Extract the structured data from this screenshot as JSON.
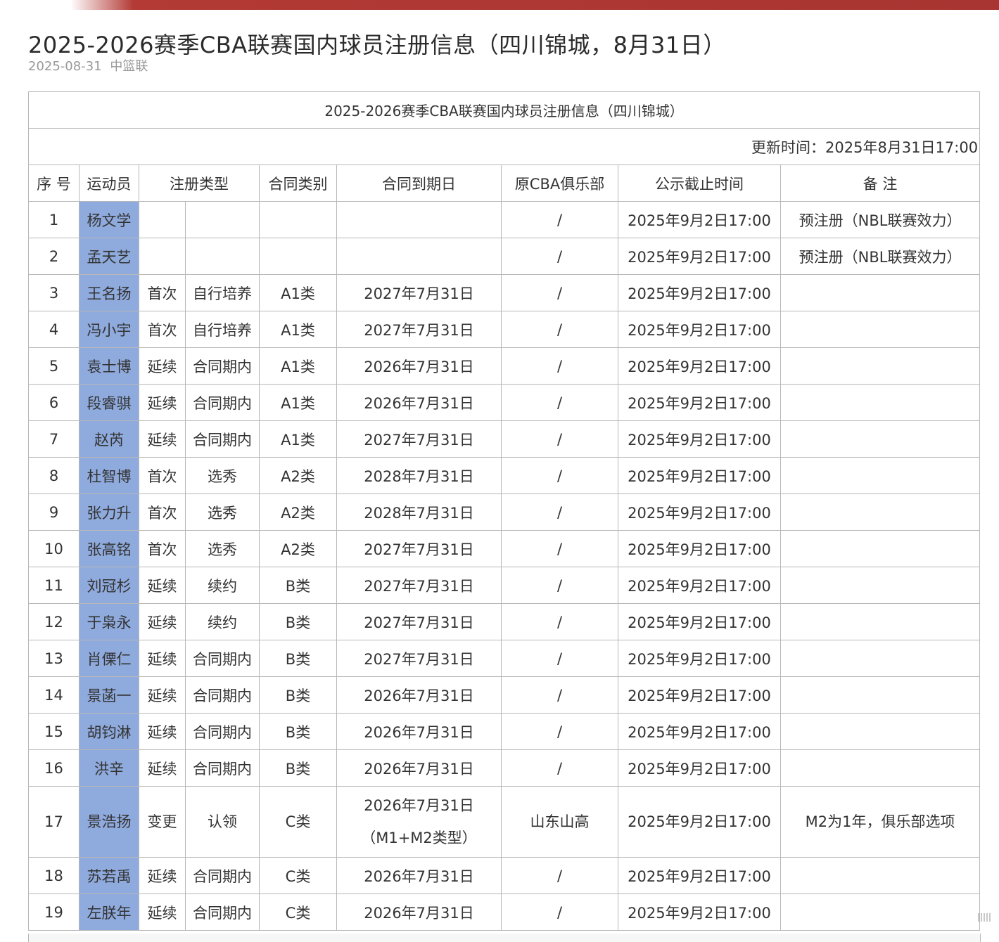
{
  "article": {
    "title": "2025-2026赛季CBA联赛国内球员注册信息（四川锦城，8月31日）",
    "date": "2025-08-31",
    "source": "中篮联"
  },
  "table": {
    "title": "2025-2026赛季CBA联赛国内球员注册信息（四川锦城）",
    "updated": "更新时间：2025年8月31日17:00",
    "headers": {
      "index": "序 号",
      "player": "运动员",
      "reg_type": "注册类型",
      "contract_class": "合同类别",
      "expiry": "合同到期日",
      "prev_club": "原CBA俱乐部",
      "deadline": "公示截止时间",
      "note": "备 注"
    },
    "rows": [
      {
        "no": "1",
        "player": "杨文学",
        "reg1": "",
        "reg2": "",
        "class": "",
        "expiry": "",
        "expiry2": "",
        "prev": "/",
        "deadline": "2025年9月2日17:00",
        "note": "预注册（NBL联赛效力）"
      },
      {
        "no": "2",
        "player": "孟天艺",
        "reg1": "",
        "reg2": "",
        "class": "",
        "expiry": "",
        "expiry2": "",
        "prev": "/",
        "deadline": "2025年9月2日17:00",
        "note": "预注册（NBL联赛效力）"
      },
      {
        "no": "3",
        "player": "王名扬",
        "reg1": "首次",
        "reg2": "自行培养",
        "class": "A1类",
        "expiry": "2027年7月31日",
        "expiry2": "",
        "prev": "/",
        "deadline": "2025年9月2日17:00",
        "note": ""
      },
      {
        "no": "4",
        "player": "冯小宇",
        "reg1": "首次",
        "reg2": "自行培养",
        "class": "A1类",
        "expiry": "2027年7月31日",
        "expiry2": "",
        "prev": "/",
        "deadline": "2025年9月2日17:00",
        "note": ""
      },
      {
        "no": "5",
        "player": "袁士博",
        "reg1": "延续",
        "reg2": "合同期内",
        "class": "A1类",
        "expiry": "2026年7月31日",
        "expiry2": "",
        "prev": "/",
        "deadline": "2025年9月2日17:00",
        "note": ""
      },
      {
        "no": "6",
        "player": "段睿骐",
        "reg1": "延续",
        "reg2": "合同期内",
        "class": "A1类",
        "expiry": "2026年7月31日",
        "expiry2": "",
        "prev": "/",
        "deadline": "2025年9月2日17:00",
        "note": ""
      },
      {
        "no": "7",
        "player": "赵芮",
        "reg1": "延续",
        "reg2": "合同期内",
        "class": "A1类",
        "expiry": "2027年7月31日",
        "expiry2": "",
        "prev": "/",
        "deadline": "2025年9月2日17:00",
        "note": ""
      },
      {
        "no": "8",
        "player": "杜智博",
        "reg1": "首次",
        "reg2": "选秀",
        "class": "A2类",
        "expiry": "2028年7月31日",
        "expiry2": "",
        "prev": "/",
        "deadline": "2025年9月2日17:00",
        "note": ""
      },
      {
        "no": "9",
        "player": "张力升",
        "reg1": "首次",
        "reg2": "选秀",
        "class": "A2类",
        "expiry": "2028年7月31日",
        "expiry2": "",
        "prev": "/",
        "deadline": "2025年9月2日17:00",
        "note": ""
      },
      {
        "no": "10",
        "player": "张高铭",
        "reg1": "首次",
        "reg2": "选秀",
        "class": "A2类",
        "expiry": "2027年7月31日",
        "expiry2": "",
        "prev": "/",
        "deadline": "2025年9月2日17:00",
        "note": ""
      },
      {
        "no": "11",
        "player": "刘冠杉",
        "reg1": "延续",
        "reg2": "续约",
        "class": "B类",
        "expiry": "2027年7月31日",
        "expiry2": "",
        "prev": "/",
        "deadline": "2025年9月2日17:00",
        "note": ""
      },
      {
        "no": "12",
        "player": "于枭永",
        "reg1": "延续",
        "reg2": "续约",
        "class": "B类",
        "expiry": "2027年7月31日",
        "expiry2": "",
        "prev": "/",
        "deadline": "2025年9月2日17:00",
        "note": ""
      },
      {
        "no": "13",
        "player": "肖傈仁",
        "reg1": "延续",
        "reg2": "合同期内",
        "class": "B类",
        "expiry": "2027年7月31日",
        "expiry2": "",
        "prev": "/",
        "deadline": "2025年9月2日17:00",
        "note": ""
      },
      {
        "no": "14",
        "player": "景菡一",
        "reg1": "延续",
        "reg2": "合同期内",
        "class": "B类",
        "expiry": "2026年7月31日",
        "expiry2": "",
        "prev": "/",
        "deadline": "2025年9月2日17:00",
        "note": ""
      },
      {
        "no": "15",
        "player": "胡钧淋",
        "reg1": "延续",
        "reg2": "合同期内",
        "class": "B类",
        "expiry": "2026年7月31日",
        "expiry2": "",
        "prev": "/",
        "deadline": "2025年9月2日17:00",
        "note": ""
      },
      {
        "no": "16",
        "player": "洪辛",
        "reg1": "延续",
        "reg2": "合同期内",
        "class": "B类",
        "expiry": "2026年7月31日",
        "expiry2": "",
        "prev": "/",
        "deadline": "2025年9月2日17:00",
        "note": ""
      },
      {
        "no": "17",
        "player": "景浩扬",
        "reg1": "变更",
        "reg2": "认领",
        "class": "C类",
        "expiry": "2026年7月31日",
        "expiry2": "（M1+M2类型）",
        "prev": "山东山高",
        "deadline": "2025年9月2日17:00",
        "note": "M2为1年，俱乐部选项"
      },
      {
        "no": "18",
        "player": "苏若禹",
        "reg1": "延续",
        "reg2": "合同期内",
        "class": "C类",
        "expiry": "2026年7月31日",
        "expiry2": "",
        "prev": "/",
        "deadline": "2025年9月2日17:00",
        "note": ""
      },
      {
        "no": "19",
        "player": "左朕年",
        "reg1": "延续",
        "reg2": "合同期内",
        "class": "C类",
        "expiry": "2026年7月31日",
        "expiry2": "",
        "prev": "/",
        "deadline": "2025年9月2日17:00",
        "note": ""
      }
    ]
  },
  "colors": {
    "player_cell": "#8faadc",
    "top_bar": "#a83531"
  },
  "icons": {
    "image_badge": "image-gallery-icon"
  }
}
